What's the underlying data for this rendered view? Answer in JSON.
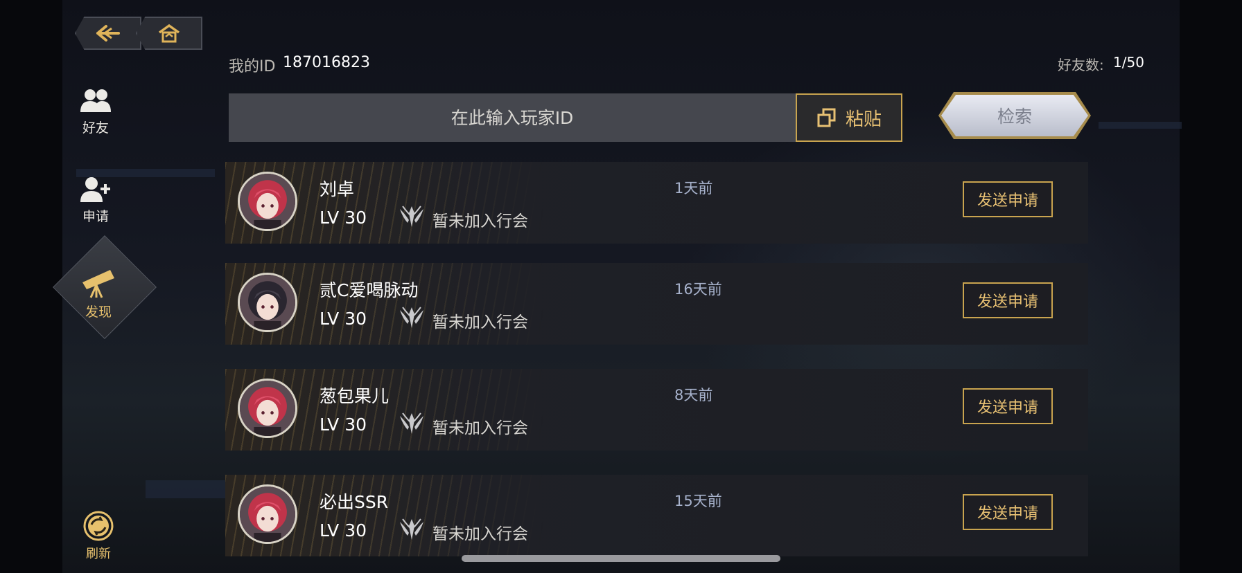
{
  "nav": {
    "back_icon": "back-arrow-icon",
    "home_icon": "home-icon"
  },
  "sidebar": {
    "items": [
      {
        "label": "好友",
        "icon": "friends-icon"
      },
      {
        "label": "申请",
        "icon": "add-friend-icon"
      },
      {
        "label": "发现",
        "icon": "telescope-icon",
        "active": true
      },
      {
        "label": "刷新",
        "icon": "refresh-icon"
      }
    ]
  },
  "header": {
    "my_id_label": "我的ID",
    "my_id_value": "187016823",
    "friend_count_label": "好友数:",
    "friend_count_value": "1/50"
  },
  "search": {
    "placeholder": "在此输入玩家ID",
    "paste_label": "粘贴",
    "search_label": "检索"
  },
  "players": [
    {
      "name": "刘卓",
      "level": "LV 30",
      "guild": "暂未加入行会",
      "last_seen": "1天前",
      "action": "发送申请",
      "avatar": "red-hair"
    },
    {
      "name": "贰C爱喝脉动",
      "level": "LV 30",
      "guild": "暂未加入行会",
      "last_seen": "16天前",
      "action": "发送申请",
      "avatar": "dark-hair"
    },
    {
      "name": "葱包果儿",
      "level": "LV 30",
      "guild": "暂未加入行会",
      "last_seen": "8天前",
      "action": "发送申请",
      "avatar": "red-hair"
    },
    {
      "name": "必出SSR",
      "level": "LV 30",
      "guild": "暂未加入行会",
      "last_seen": "15天前",
      "action": "发送申请",
      "avatar": "red-hair"
    }
  ],
  "colors": {
    "accent_gold": "#c9a44f",
    "time_blue": "#a7b2cc"
  }
}
